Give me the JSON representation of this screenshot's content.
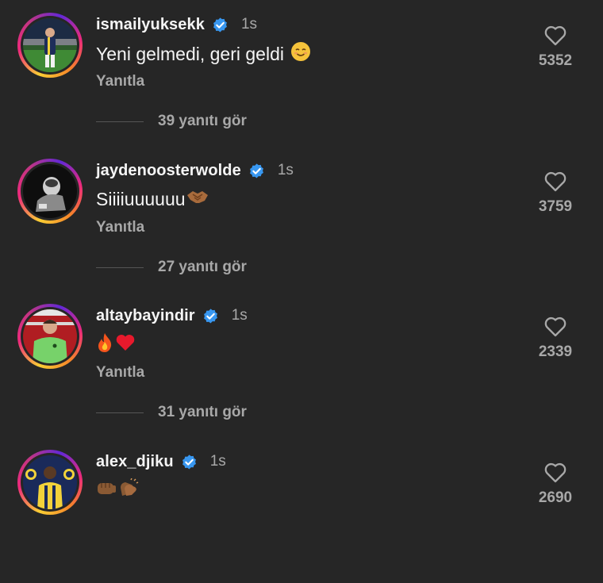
{
  "colors": {
    "background": "#262626",
    "primary_text": "#f5f5f5",
    "secondary_text": "#a8a8a8",
    "verified_blue": "#3897f0"
  },
  "comments": [
    {
      "username": "ismailyuksekk",
      "verified": true,
      "time": "1s",
      "text": "Yeni gelmedi, geri geldi",
      "emoji": "relieved-face",
      "reply_label": "Yanıtla",
      "view_replies": "39 yanıtı gör",
      "likes": "5352",
      "avatar": "player-in-stadium"
    },
    {
      "username": "jaydenoosterwolde",
      "verified": true,
      "time": "1s",
      "text": "Siiiiuuuuuu",
      "emoji": "handshake",
      "reply_label": "Yanıtla",
      "view_replies": "27 yanıtı gör",
      "likes": "3759",
      "avatar": "black-white-portrait"
    },
    {
      "username": "altaybayindir",
      "verified": true,
      "time": "1s",
      "text": "",
      "emoji": "fire-and-red-heart",
      "reply_label": "Yanıtla",
      "view_replies": "31 yanıtı gör",
      "likes": "2339",
      "avatar": "goalkeeper-green-kit"
    },
    {
      "username": "alex_djiku",
      "verified": true,
      "time": "1s",
      "text": "",
      "emoji": "fist-bump-and-clapping",
      "likes": "2690",
      "avatar": "player-with-club-crests"
    }
  ]
}
